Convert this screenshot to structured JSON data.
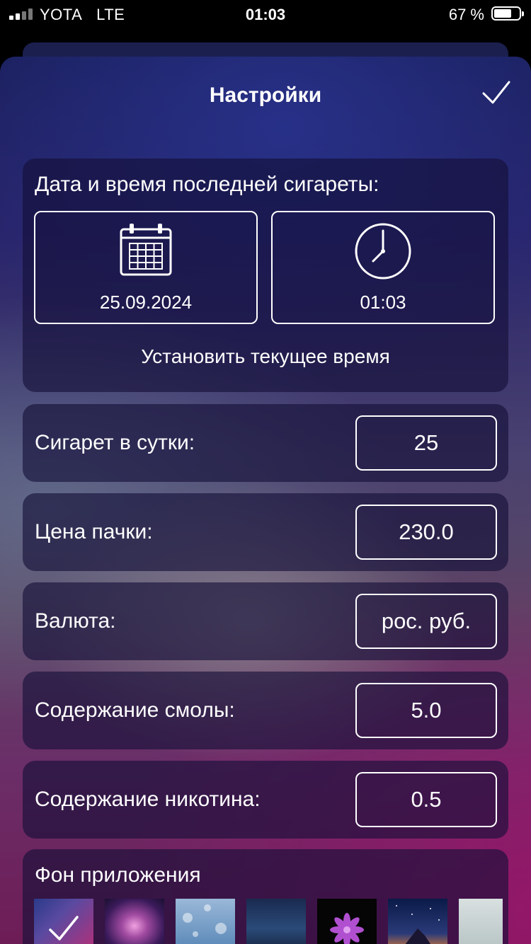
{
  "status_bar": {
    "carrier": "YOTA",
    "network": "LTE",
    "time": "01:03",
    "battery_pct": "67 %",
    "battery_level": 0.67
  },
  "header": {
    "title": "Настройки",
    "done_icon": "checkmark-icon"
  },
  "last_cigarette": {
    "label": "Дата и время последней сигареты:",
    "date": "25.09.2024",
    "time": "01:03",
    "date_icon": "calendar-icon",
    "time_icon": "clock-icon",
    "set_now_label": "Установить текущее время"
  },
  "fields": [
    {
      "label": "Сигарет в сутки:",
      "value": "25"
    },
    {
      "label": "Цена пачки:",
      "value": "230.0"
    },
    {
      "label": "Валюта:",
      "value": "рос. руб."
    },
    {
      "label": "Содержание смолы:",
      "value": "5.0"
    },
    {
      "label": "Содержание никотина:",
      "value": "0.5"
    }
  ],
  "background": {
    "label": "Фон приложения",
    "selected_index": 0,
    "thumbnails": [
      "wallpaper-1",
      "wallpaper-2",
      "wallpaper-3",
      "wallpaper-4",
      "wallpaper-5",
      "wallpaper-6",
      "wallpaper-7"
    ]
  },
  "colors": {
    "sheet_top": "#1a1f5a",
    "sheet_bottom": "#6e1c56",
    "card": "#140f37",
    "text": "#ffffff"
  }
}
